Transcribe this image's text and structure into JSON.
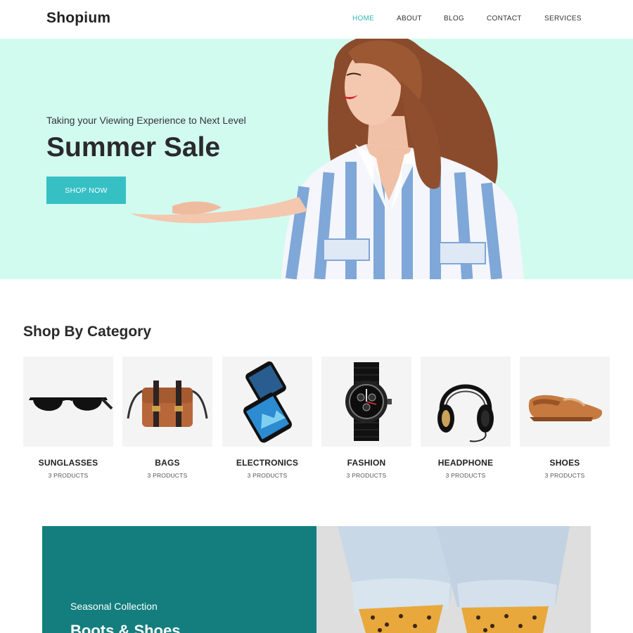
{
  "header": {
    "logo": "Shopium",
    "nav": [
      {
        "label": "HOME",
        "active": true
      },
      {
        "label": "ABOUT",
        "active": false
      },
      {
        "label": "BLOG",
        "active": false
      },
      {
        "label": "CONTACT",
        "active": false
      },
      {
        "label": "SERVICES",
        "active": false
      }
    ]
  },
  "hero": {
    "subtitle": "Taking your Viewing Experience to Next Level",
    "title": "Summer Sale",
    "button_label": "SHOP NOW"
  },
  "categories": {
    "title": "Shop By Category",
    "items": [
      {
        "name": "SUNGLASSES",
        "count": "3 PRODUCTS",
        "icon": "sunglasses-icon"
      },
      {
        "name": "BAGS",
        "count": "3 PRODUCTS",
        "icon": "bag-icon"
      },
      {
        "name": "ELECTRONICS",
        "count": "3 PRODUCTS",
        "icon": "smartphone-icon"
      },
      {
        "name": "FASHION",
        "count": "3 PRODUCTS",
        "icon": "watch-icon"
      },
      {
        "name": "HEADPHONE",
        "count": "3 PRODUCTS",
        "icon": "headphone-icon"
      },
      {
        "name": "SHOES",
        "count": "3 PRODUCTS",
        "icon": "shoe-icon"
      }
    ]
  },
  "seasonal": {
    "subtitle": "Seasonal Collection",
    "title": "Boots & Shoes"
  },
  "colors": {
    "accent": "#36c0c4",
    "hero_bg": "#d2fbf0",
    "banner_bg": "#137e7d"
  }
}
